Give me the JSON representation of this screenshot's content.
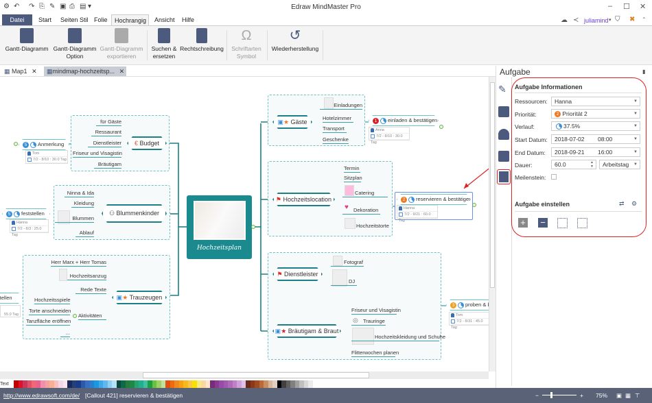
{
  "titlebar": {
    "title": "Edraw MindMaster Pro",
    "user": "juliamind"
  },
  "menu": {
    "tabs": [
      "Datei",
      "Start",
      "Seiten Stil",
      "Folie",
      "Hochrangig",
      "Ansicht",
      "Hilfe"
    ]
  },
  "ribbon": {
    "buttons": [
      {
        "l1": "Gantt-Diagramm",
        "l2": ""
      },
      {
        "l1": "Gantt-Diagramm",
        "l2": "Option"
      },
      {
        "l1": "Gantt-Diagramm",
        "l2": "exportieren"
      },
      {
        "l1": "Suchen &",
        "l2": "ersetzen"
      },
      {
        "l1": "Rechtschreibung",
        "l2": ""
      },
      {
        "l1": "Schriftarten",
        "l2": "Symbol"
      },
      {
        "l1": "Wiederherstellung",
        "l2": ""
      }
    ]
  },
  "doctabs": [
    {
      "label": "Map1"
    },
    {
      "label": "mindmap-hochzeitsp..."
    }
  ],
  "mindmap": {
    "central": "Hochzeitsplan",
    "budget": {
      "label": "Budget",
      "children": [
        "für Gäste",
        "Ressaurant",
        "Dienstleister",
        "Friseur und Visagistin",
        "Bräutigam"
      ]
    },
    "anmerkung": {
      "label": "Anmerkung",
      "badge": "5",
      "person": "Tom",
      "dates": "7/2 - 8/10 : 30.0 Tag"
    },
    "blummenkinder": {
      "label": "Blummenkinder",
      "children": [
        "Ninna & Ida",
        "Kleidung",
        "Blummen",
        "Ablauf"
      ]
    },
    "feststellen": {
      "label": "feststellen",
      "badge": "5",
      "person": "Hanna",
      "dates": "7/2 - 8/3 : 25.0 Tag"
    },
    "trauzeugen": {
      "label": "Trauzeugen",
      "children": [
        "Herr Marx + Herr Tomas",
        "Hochzeitsanzug",
        "Rede Texte",
        "Aktivitäten"
      ],
      "sub": [
        "Hochzeitsspiele",
        "Torte anschneiden",
        "Tanzfläche eröffnen",
        "..."
      ]
    },
    "partial": {
      "label": "itellen",
      "dates": "55.0 Tag"
    },
    "gaeste": {
      "label": "Gäste",
      "children": [
        "Einladungen",
        "Hotelzimmer",
        "Transport",
        "Geschenke"
      ]
    },
    "einladen": {
      "label": "einladen  & bestätigen",
      "badge": "1",
      "person": "Anna",
      "dates": "7/2 - 8/10 : 30.0 Tag"
    },
    "location": {
      "label": "Hochzeitslocation",
      "children": [
        "Termin",
        "Sitzplan",
        "Catering",
        "Dekoration",
        "Hochzeitstorte"
      ]
    },
    "reservieren": {
      "label": "reservieren & bestätigen",
      "badge": "2",
      "person": "Hanna",
      "dates": "7/2 - 9/21 : 60.0 Tag"
    },
    "dienstleister": {
      "label": "Dienstleister",
      "children": [
        "Fotograf",
        "DJ"
      ]
    },
    "braut": {
      "label": "Bräutigam & Braut",
      "children": [
        "Friseur und Visagistin",
        "Trauringe",
        "Hochzeitskleidung und Schuhe",
        "Flitterwochen planen"
      ]
    },
    "proben": {
      "label": "proben & bu",
      "badge": "3",
      "person": "Tom",
      "dates": "7/2 - 8/31 : 45.0 Tag"
    }
  },
  "panel": {
    "title": "Aufgabe",
    "section1": "Aufgabe Informationen",
    "ressourcen_label": "Ressourcen:",
    "ressourcen": "Hanna",
    "prioritaet_label": "Priorität:",
    "prioritaet": "Priorität 2",
    "prioritaet_badge": "2",
    "verlauf_label": "Verlauf:",
    "verlauf": "37.5%",
    "verlauf_value": 37.5,
    "start_label": "Start Datum:",
    "start_date": "2018-07-02",
    "start_time": "08:00",
    "end_label": "End Datum:",
    "end_date": "2018-09-21",
    "end_time": "16:00",
    "dauer_label": "Dauer:",
    "dauer": "60.0",
    "dauer_unit": "Arbeitstag",
    "meilenstein_label": "Meilenstein:",
    "meilenstein": false,
    "section2": "Aufgabe einstellen"
  },
  "palette": {
    "label": "Text",
    "colors": [
      "#c00000",
      "#e0102a",
      "#c8385a",
      "#e05068",
      "#f06878",
      "#e86090",
      "#f090a8",
      "#f4a0a0",
      "#f8b090",
      "#f8c0c0",
      "#f4d8e8",
      "#fde4ee",
      "#1a2a5a",
      "#24407a",
      "#1a3a8a",
      "#2a5aa8",
      "#3a6ec0",
      "#2a80d0",
      "#1a98e0",
      "#40a8e8",
      "#60b8f0",
      "#90cff0",
      "#b8e0f8",
      "#0a4a3a",
      "#0a6a4a",
      "#2a7a3a",
      "#1a8a4a",
      "#2aa06a",
      "#20b090",
      "#40c0a0",
      "#1aa040",
      "#6ac040",
      "#a0d060",
      "#c0e0a0",
      "#e05010",
      "#f06a10",
      "#f08a20",
      "#f8a010",
      "#f8b820",
      "#f8c840",
      "#f8e000",
      "#f8e880",
      "#f8d8a0",
      "#fce8c8",
      "#7a2a7a",
      "#8a3a90",
      "#9a4aa8",
      "#a05ab0",
      "#b06ab8",
      "#c080c8",
      "#d0a0d8",
      "#e0c0e8",
      "#6a2a1a",
      "#8a3a1a",
      "#a04a20",
      "#b86a3a",
      "#c89060",
      "#d8b898",
      "#e0d0c0",
      "#000000",
      "#404040",
      "#606060",
      "#808080",
      "#a0a0a0",
      "#c0c0c0",
      "#d8d8d8",
      "#ececec"
    ]
  },
  "status": {
    "url": "http://www.edrawsoft.com/de/",
    "callout": "[Callout 421]",
    "selection": "reservieren & bestätigen",
    "zoom": "75%",
    "minus": "−",
    "plus": "+"
  }
}
